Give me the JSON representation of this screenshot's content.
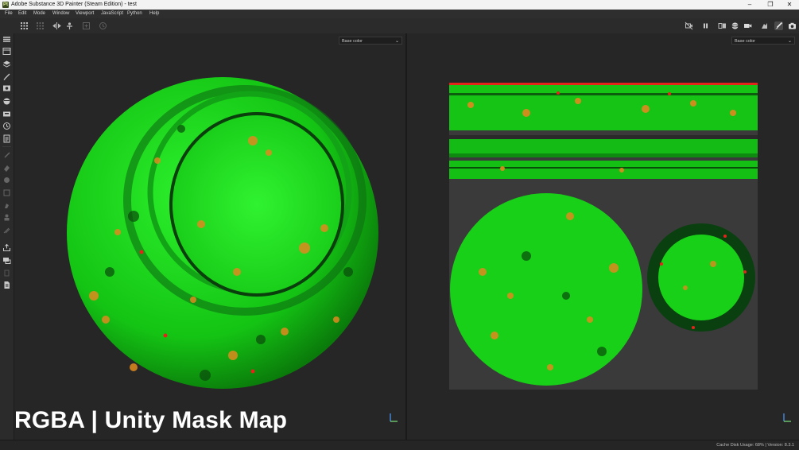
{
  "window": {
    "title": "Adobe Substance 3D Painter (Steam Edition) - test",
    "app_icon_letter": "Pt",
    "minimize": "–",
    "maximize": "❐",
    "close": "✕"
  },
  "menu": [
    "File",
    "Edit",
    "Mode",
    "Window",
    "Viewport",
    "JavaScript",
    "Python",
    "Help"
  ],
  "toolbar": {
    "left_icons": [
      "grid-icon",
      "grid-dim-icon",
      "symmetry-icon",
      "axis-icon",
      "add-icon",
      "history-icon"
    ],
    "right_icons": [
      "camera-off-icon",
      "pause-icon",
      "split-view-icon",
      "sphere-icon",
      "camera-icon",
      "hand-icon",
      "paint-brush-icon",
      "screenshot-icon"
    ]
  },
  "sidebar_icons": [
    "layers-icon",
    "texture-set-icon",
    "layer-stack-icon",
    "brush-settings-icon",
    "display-icon",
    "environment-icon",
    "camera-settings-icon",
    "history-icon",
    "log-icon",
    "paint-icon",
    "eraser-icon",
    "projection-icon",
    "geometry-mask-icon",
    "smudge-icon",
    "clone-icon",
    "fill-icon",
    "export-icon",
    "bake-icon",
    "bucket-icon",
    "document-icon"
  ],
  "viewport_3d": {
    "channel": "Base color"
  },
  "viewport_2d": {
    "channel": "Base color"
  },
  "overlay_caption": "RGBA | Unity Mask Map",
  "status": {
    "cache": "Cache Disk Usage:  68% | Version: 8.3.1"
  },
  "colors": {
    "accent_green": "#19e619",
    "rust_orange": "#e08a1e",
    "rust_red": "#e3241b",
    "background": "#262626"
  }
}
